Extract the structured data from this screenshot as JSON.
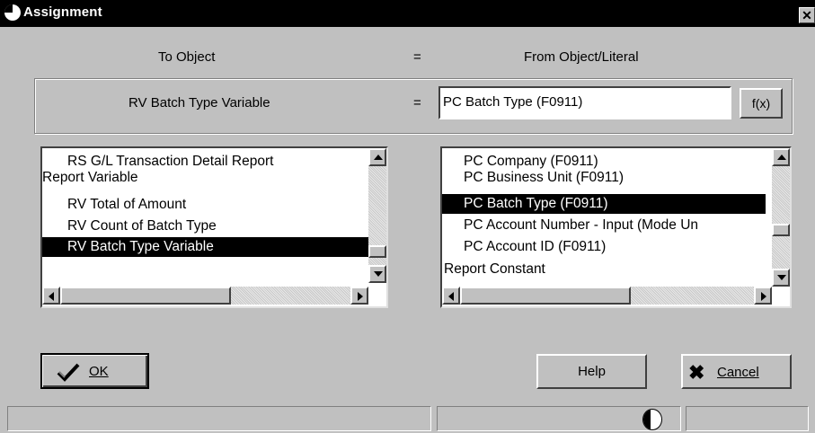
{
  "window": {
    "title": "Assignment",
    "close_glyph": "✕"
  },
  "headers": {
    "to_object": "To Object",
    "equals": "=",
    "from_object": "From Object/Literal"
  },
  "assignment": {
    "to_value": "RV Batch Type Variable",
    "equals": "=",
    "from_value": "PC Batch Type (F0911)",
    "fx_label": "f(x)"
  },
  "left_list": {
    "items": [
      {
        "label": "RS G/L Transaction Detail Report",
        "indent": true,
        "selected": false
      },
      {
        "label": "Report Variable",
        "indent": false,
        "selected": false
      },
      {
        "label": "RV Total of Amount",
        "indent": true,
        "selected": false
      },
      {
        "label": "RV Count of Batch Type",
        "indent": true,
        "selected": false
      },
      {
        "label": "RV Batch Type Variable",
        "indent": true,
        "selected": true
      }
    ]
  },
  "right_list": {
    "items": [
      {
        "label": "PC Company (F0911)",
        "indent": true,
        "selected": false
      },
      {
        "label": "PC Business Unit (F0911)",
        "indent": true,
        "selected": false
      },
      {
        "label": "PC Batch Type (F0911)",
        "indent": true,
        "selected": true
      },
      {
        "label": "PC Account Number - Input (Mode Un",
        "indent": true,
        "selected": false
      },
      {
        "label": "PC Account ID (F0911)",
        "indent": true,
        "selected": false
      },
      {
        "label": "Report Constant",
        "indent": false,
        "selected": false
      }
    ]
  },
  "buttons": {
    "ok": "OK",
    "help": "Help",
    "cancel": "Cancel"
  },
  "icons": {
    "app": "globe-icon",
    "ok": "checkmark-icon",
    "cancel": "x-icon",
    "status": "globe-icon"
  },
  "colors": {
    "selection_bg": "#000000",
    "dialog_bg": "#c0c0c0",
    "titlebar_bg": "#000000"
  }
}
